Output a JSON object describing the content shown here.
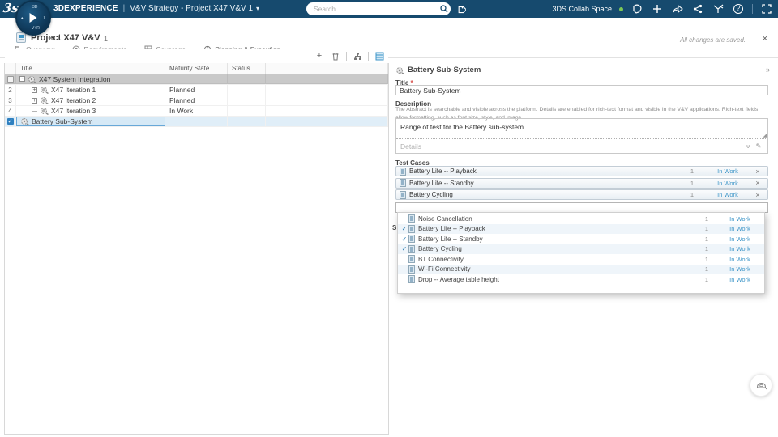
{
  "icons": {
    "check": "✓",
    "plus": "+",
    "minus": "-",
    "close": "×",
    "caret": "▾",
    "double_chevron_right": "»",
    "double_chevron_down": "»",
    "pencil": "✎",
    "question": "?",
    "resize": "◢"
  },
  "topbar": {
    "brand": "3DEXPERIENCE",
    "separator": "|",
    "app_title": "V&V Strategy - Project X47 V&V 1",
    "search_placeholder": "Search",
    "collab_space": "3DS Collab Space"
  },
  "header": {
    "title": "Project X47 V&V",
    "revision": "1",
    "save_status": "All changes are saved."
  },
  "tabs": [
    {
      "label": "Overview"
    },
    {
      "label": "Requirements"
    },
    {
      "label": "Coverage"
    },
    {
      "label": "Planning & Execution"
    }
  ],
  "table": {
    "columns": {
      "title": "Title",
      "maturity": "Maturity State",
      "status": "Status"
    },
    "rows": [
      {
        "num": "",
        "title": "X47 System Integration",
        "maturity": "",
        "status": ""
      },
      {
        "num": "2",
        "title": "X47 Iteration 1",
        "maturity": "Planned",
        "status": ""
      },
      {
        "num": "3",
        "title": "X47 Iteration 2",
        "maturity": "Planned",
        "status": ""
      },
      {
        "num": "4",
        "title": "X47 Iteration 3",
        "maturity": "In Work",
        "status": ""
      },
      {
        "num": "",
        "title": "Battery Sub-System",
        "maturity": "",
        "status": ""
      }
    ]
  },
  "panel": {
    "title": "Battery Sub-System",
    "title_label": "Title",
    "required_mark": "*",
    "title_value": "Battery Sub-System",
    "description_label": "Description",
    "description_help": "The Abstract is searchable and visible across the platform. Details are enabled for rich-text format and visible in the V&V applications. Rich-text fields allow formatting, such as font size, style, and image.",
    "abstract_value": "Range of test for the Battery sub-system",
    "details_placeholder": "Details",
    "test_cases_label": "Test Cases",
    "obscured_label": "S",
    "chips": [
      {
        "label": "Battery Life -- Playback",
        "rev": "1",
        "state": "In Work"
      },
      {
        "label": "Battery Life -- Standby",
        "rev": "1",
        "state": "In Work"
      },
      {
        "label": "Battery Cycling",
        "rev": "1",
        "state": "In Work"
      }
    ],
    "dropdown": {
      "options": [
        {
          "label": "Noise Cancellation",
          "rev": "1",
          "state": "In Work",
          "checked": false
        },
        {
          "label": "Battery Life -- Playback",
          "rev": "1",
          "state": "In Work",
          "checked": true
        },
        {
          "label": "Battery Life -- Standby",
          "rev": "1",
          "state": "In Work",
          "checked": true
        },
        {
          "label": "Battery Cycling",
          "rev": "1",
          "state": "In Work",
          "checked": true
        },
        {
          "label": "BT Connectivity",
          "rev": "1",
          "state": "In Work",
          "checked": false
        },
        {
          "label": "Wi-Fi Connectivity",
          "rev": "1",
          "state": "In Work",
          "checked": false
        },
        {
          "label": "Drop -- Average table height",
          "rev": "1",
          "state": "In Work",
          "checked": false
        }
      ]
    }
  },
  "colors": {
    "topbar": "#164a6e",
    "accent": "#3e96c8",
    "tab_underline": "#42a0d4",
    "selected_row": "#d6e9f6",
    "group_row": "#c9c9c9",
    "online_dot": "#7dc855"
  }
}
